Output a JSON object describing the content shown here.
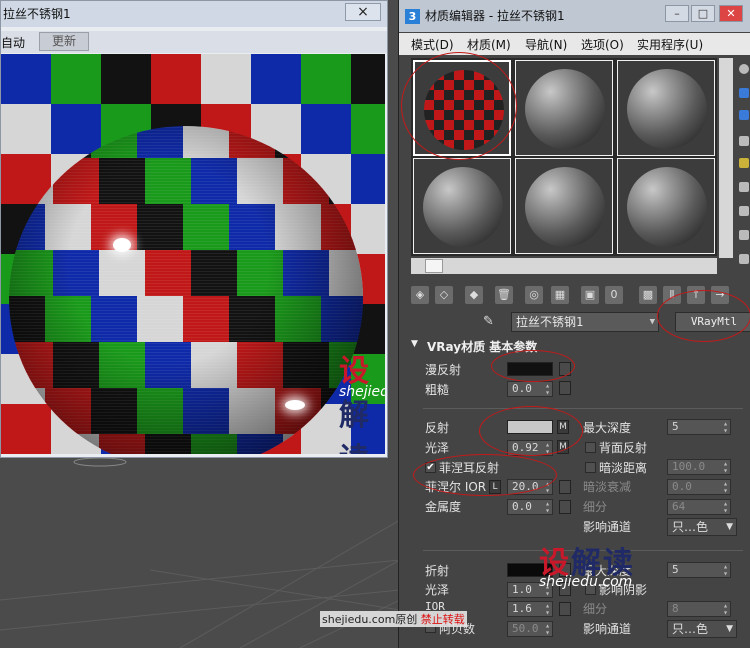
{
  "render_window": {
    "title": "拉丝不锈钢1",
    "close": "×",
    "toolbar": {
      "auto_label": "自动",
      "refresh_label": "更新"
    }
  },
  "watermark": {
    "brand_cn_a": "设",
    "brand_cn_b": "解读",
    "brand_en": "shejiedu.com",
    "footer_site": "shejiedu.com原创",
    "footer_notice": "禁止转载"
  },
  "material_editor": {
    "title": "材质编辑器 - 拉丝不锈钢1",
    "app_icon": "3",
    "window_buttons": {
      "minimize": "–",
      "maximize": "□",
      "close": "✕"
    },
    "menu": [
      "模式(D)",
      "材质(M)",
      "导航(N)",
      "选项(O)",
      "实用程序(U)"
    ],
    "material_name": "拉丝不锈钢1",
    "material_type": "VRayMtl",
    "rollout_title": "VRay材质 基本参数",
    "diffuse": {
      "label": "漫反射",
      "color": "#111111"
    },
    "roughness": {
      "label": "粗糙",
      "value": "0.0"
    },
    "reflect": {
      "label": "反射",
      "color": "#c8c8c8",
      "map_btn": "M",
      "gloss_label": "光泽",
      "gloss_value": "0.92",
      "max_depth_label": "最大深度",
      "max_depth_value": "5",
      "back_reflect_label": "背面反射",
      "dim_distance_label": "暗淡距离",
      "dim_distance_value": "100.0",
      "fresnel_label": "菲涅耳反射",
      "fresnel_checked": "✔",
      "fresnel_ior_label": "菲涅尔 IOR",
      "fresnel_lock": "L",
      "fresnel_ior_value": "20.0",
      "dim_falloff_label": "暗淡衰减",
      "dim_falloff_value": "0.0",
      "metalness_label": "金属度",
      "metalness_value": "0.0",
      "subdivs_label": "细分",
      "subdivs_value": "64",
      "affect_channels_label": "影响通道",
      "affect_channels_value": "只…色"
    },
    "refract": {
      "label": "折射",
      "color": "#0a0a0a",
      "max_depth_label": "最大深度",
      "max_depth_value": "5",
      "gloss_label": "光泽",
      "gloss_value": "1.0",
      "affect_shadows_label": "影响阴影",
      "ior_label": "IOR",
      "ior_value": "1.6",
      "subdivs_label": "细分",
      "subdivs_value": "8",
      "abbe_label": "阿贝数",
      "abbe_value": "50.0",
      "affect_channels_label": "影响通道",
      "affect_channels_value": "只…色"
    }
  },
  "colors": {
    "accent_red": "#c41a1a"
  }
}
